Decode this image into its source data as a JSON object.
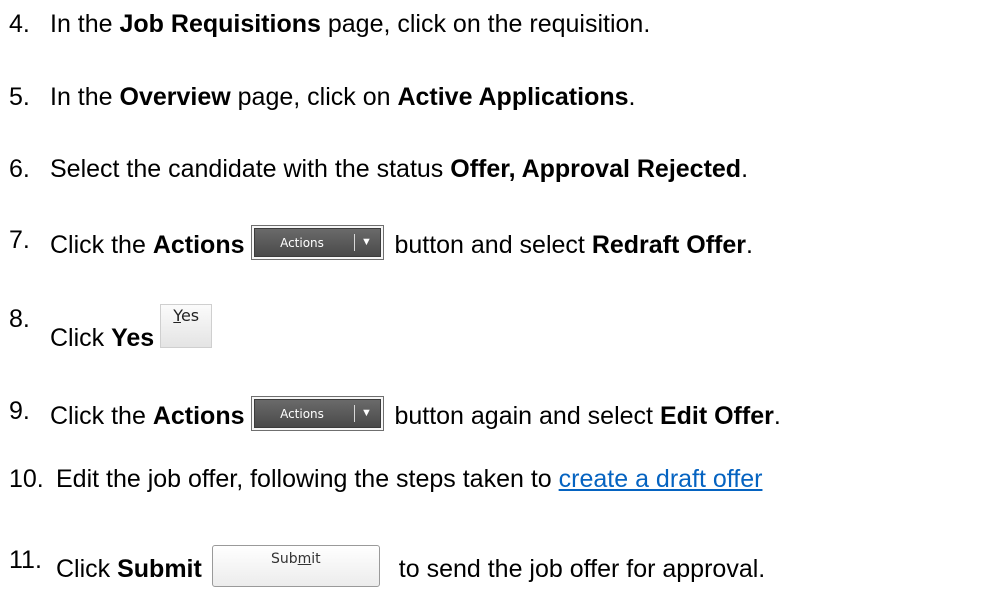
{
  "steps": [
    {
      "number": "4.",
      "parts": [
        "In the ",
        "Job Requisitions",
        " page, click on the requisition."
      ]
    },
    {
      "number": "5.",
      "parts": [
        "In the ",
        "Overview",
        " page, click on ",
        "Active Applications",
        "."
      ]
    },
    {
      "number": "6.",
      "parts": [
        "Select the candidate with the status ",
        "Offer, Approval Rejected",
        "."
      ]
    },
    {
      "number": "7.",
      "parts": [
        "Click the ",
        "Actions",
        " button and select ",
        "Redraft Offer",
        "."
      ]
    },
    {
      "number": "8.",
      "parts": [
        "Click ",
        "Yes"
      ]
    },
    {
      "number": "9.",
      "parts": [
        "Click the ",
        "Actions",
        " button again and select ",
        "Edit Offer",
        "."
      ]
    },
    {
      "number": "10.",
      "parts": [
        "Edit the job offer, following the steps taken to ",
        "create a draft offer"
      ]
    },
    {
      "number": "11.",
      "parts": [
        "Click ",
        "Submit",
        " to send the job offer for approval."
      ]
    }
  ],
  "buttons": {
    "actions_label": "Actions",
    "actions_arrow": "▼",
    "yes_underlined": "Y",
    "yes_rest": "es",
    "submit_pre": "Sub",
    "submit_underlined": "m",
    "submit_post": "it"
  },
  "colors": {
    "link": "#0563c1",
    "text": "#000000"
  }
}
